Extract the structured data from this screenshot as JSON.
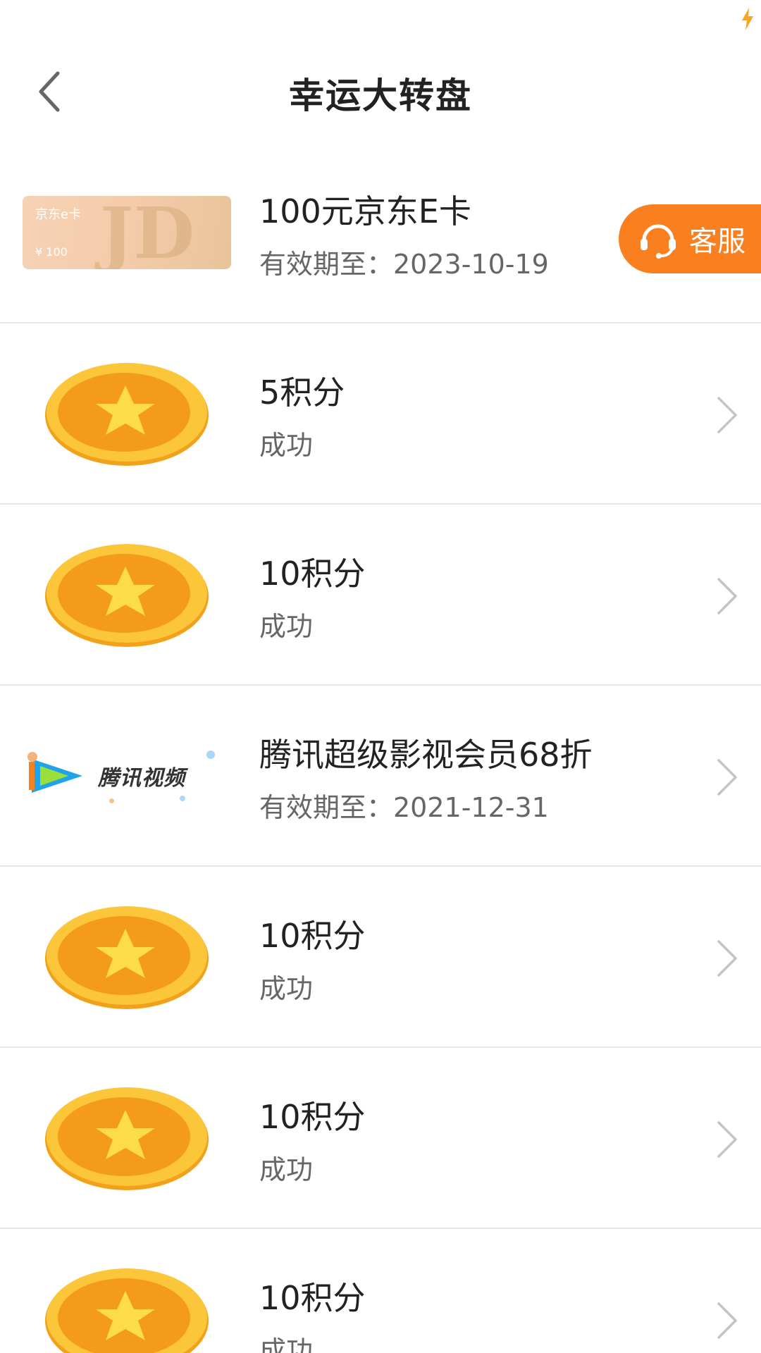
{
  "header": {
    "title": "幸运大转盘",
    "back_icon": "chevron-left-icon"
  },
  "floating": {
    "customer_service_label": "客服",
    "icon": "headset-icon"
  },
  "jd_thumb": {
    "label": "京东e卡",
    "price": "¥ 100",
    "logo_text": "JD"
  },
  "tencent_thumb": {
    "logo_text": "腾讯视频"
  },
  "records": [
    {
      "thumb": "jd-e-card",
      "title": "100元京东E卡",
      "subtitle": "有效期至：2023-10-19",
      "has_chevron": false
    },
    {
      "thumb": "coin",
      "title": "5积分",
      "subtitle": "成功",
      "has_chevron": true
    },
    {
      "thumb": "coin",
      "title": "10积分",
      "subtitle": "成功",
      "has_chevron": true
    },
    {
      "thumb": "tencent-video",
      "title": "腾讯超级影视会员68折",
      "subtitle": "有效期至：2021-12-31",
      "has_chevron": true
    },
    {
      "thumb": "coin",
      "title": "10积分",
      "subtitle": "成功",
      "has_chevron": true
    },
    {
      "thumb": "coin",
      "title": "10积分",
      "subtitle": "成功",
      "has_chevron": true
    },
    {
      "thumb": "coin",
      "title": "10积分",
      "subtitle": "成功",
      "has_chevron": true
    }
  ],
  "colors": {
    "accent": "#f97f1f",
    "coin_outer": "#f7b21c",
    "coin_inner": "#f39a1a",
    "star": "#fcdc4a",
    "divider": "#e6e6e6"
  }
}
